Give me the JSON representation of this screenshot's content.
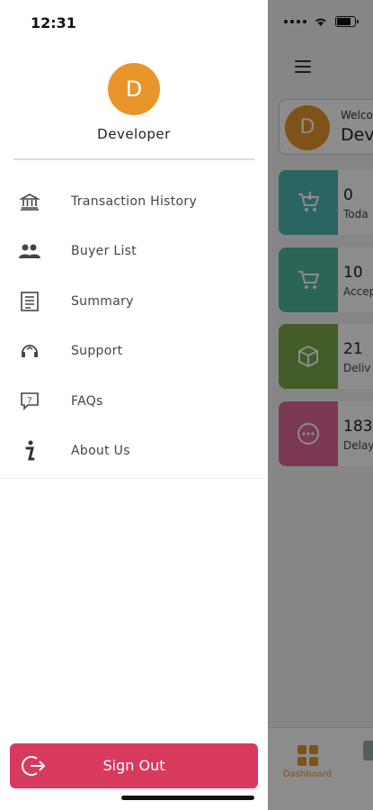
{
  "status_bar": {
    "time": "12:31"
  },
  "drawer": {
    "avatar_initial": "D",
    "user_name": "Developer",
    "menu": [
      {
        "label": "Transaction History",
        "icon": "bank-icon"
      },
      {
        "label": "Buyer List",
        "icon": "people-icon"
      },
      {
        "label": "Summary",
        "icon": "summary-list-icon"
      },
      {
        "label": "Support",
        "icon": "headset-icon"
      },
      {
        "label": "FAQs",
        "icon": "question-chat-icon"
      },
      {
        "label": "About Us",
        "icon": "info-icon"
      }
    ],
    "sign_out_label": "Sign Out"
  },
  "dashboard": {
    "welcome_text": "Welco",
    "welcome_name": "Dev",
    "avatar_initial": "D",
    "stats": [
      {
        "value": "0",
        "label": "Toda",
        "color": "#4fb8b3",
        "icon": "cart-download-icon"
      },
      {
        "value": "10",
        "label": "Accep",
        "color": "#4fb8a0",
        "icon": "cart-icon"
      },
      {
        "value": "21",
        "label": "Deliv",
        "color": "#7aa84a",
        "icon": "box-icon"
      },
      {
        "value": "183",
        "label": "Delay",
        "color": "#e0679a",
        "icon": "more-circle-icon"
      }
    ],
    "nav": {
      "dashboard_label": "Dashboard"
    }
  },
  "colors": {
    "accent": "#e8962b",
    "sign_out": "#d83a5e"
  }
}
